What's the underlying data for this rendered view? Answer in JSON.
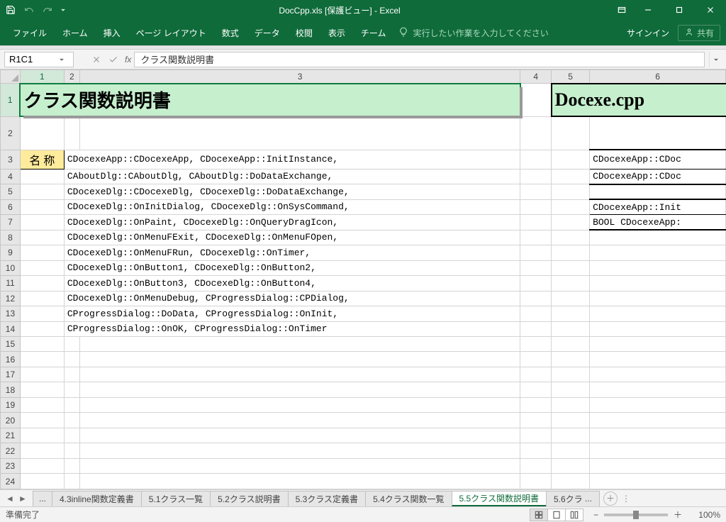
{
  "title": "DocCpp.xls  [保護ビュー] - Excel",
  "ribbon": {
    "file": "ファイル",
    "home": "ホーム",
    "insert": "挿入",
    "layout": "ページ レイアウト",
    "formulas": "数式",
    "data": "データ",
    "review": "校閲",
    "view": "表示",
    "team": "チーム",
    "tell": "実行したい作業を入力してください",
    "signin": "サインイン",
    "share": "共有"
  },
  "namebox": "R1C1",
  "formula": "クラス関数説明書",
  "cols": [
    "1",
    "2",
    "3",
    "4",
    "5",
    "6"
  ],
  "rows": [
    "1",
    "2",
    "3",
    "4",
    "5",
    "6",
    "7",
    "8",
    "9",
    "10",
    "11",
    "12",
    "13",
    "14",
    "15",
    "16",
    "17",
    "18",
    "19",
    "20",
    "21",
    "22",
    "23",
    "24"
  ],
  "cells": {
    "title_left": "クラス関数説明書",
    "title_right": "Docexe.cpp",
    "r3c1": "名 称",
    "r3c2": "CDocexeApp::CDocexeApp, CDocexeApp::InitInstance,",
    "r4c2": "CAboutDlg::CAboutDlg, CAboutDlg::DoDataExchange,",
    "r5c2": "CDocexeDlg::CDocexeDlg, CDocexeDlg::DoDataExchange,",
    "r6c2": "CDocexeDlg::OnInitDialog, CDocexeDlg::OnSysCommand,",
    "r7c2": "CDocexeDlg::OnPaint, CDocexeDlg::OnQueryDragIcon,",
    "r8c2": "CDocexeDlg::OnMenuFExit, CDocexeDlg::OnMenuFOpen,",
    "r9c2": "CDocexeDlg::OnMenuFRun, CDocexeDlg::OnTimer,",
    "r10c2": "CDocexeDlg::OnButton1, CDocexeDlg::OnButton2,",
    "r11c2": "CDocexeDlg::OnButton3, CDocexeDlg::OnButton4,",
    "r12c2": "CDocexeDlg::OnMenuDebug, CProgressDialog::CPDialog,",
    "r13c2": "CProgressDialog::DoData, CProgressDialog::OnInit,",
    "r14c2": "CProgressDialog::OnOK, CProgressDialog::OnTimer",
    "r3c6": "CDocexeApp::CDoc",
    "r4c6": "CDocexeApp::CDoc",
    "r6c6": "CDocexeApp::Init",
    "r7c6": "BOOL CDocexeApp:"
  },
  "sheets": {
    "more": "...",
    "s1": "4.3inline関数定義書",
    "s2": "5.1クラス一覧",
    "s3": "5.2クラス説明書",
    "s4": "5.3クラス定義書",
    "s5": "5.4クラス関数一覧",
    "s6": "5.5クラス関数説明書",
    "s7": "5.6クラ",
    "s7more": "...",
    "add": "+"
  },
  "status": {
    "ready": "準備完了",
    "zoom": "100%"
  }
}
